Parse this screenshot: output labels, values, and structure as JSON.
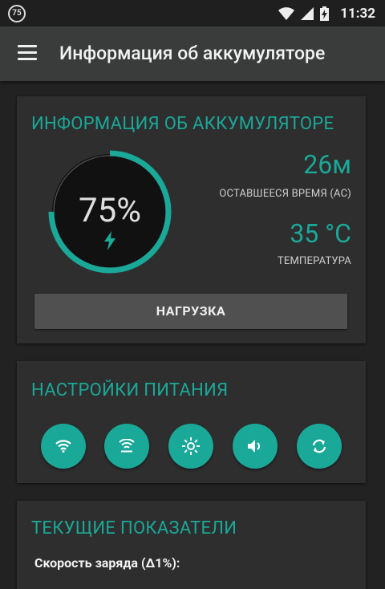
{
  "status_bar": {
    "notification": "75",
    "time": "11:32",
    "icons": [
      "wifi-icon",
      "signal-icon",
      "battery-charging-icon"
    ]
  },
  "app_bar": {
    "title": "Информация об аккумуляторе",
    "menu_icon": "hamburger-menu-icon"
  },
  "battery_card": {
    "title": "ИНФОРМАЦИЯ ОБ АККУМУЛЯТОРЕ",
    "percent_text": "75%",
    "level": 0.75,
    "time_value": "26м",
    "time_label": "ОСТАВШЕЕСЯ ВРЕМЯ (AC)",
    "temp_value": "35 °C",
    "temp_label": "ТЕМПЕРАТУРА",
    "load_button": "НАГРУЗКА",
    "accent_color": "#1aa898"
  },
  "power_card": {
    "title": "НАСТРОЙКИ ПИТАНИЯ",
    "toggles": [
      "wifi-icon",
      "wifi-tethering-icon",
      "brightness-icon",
      "volume-icon",
      "sync-icon"
    ]
  },
  "metrics_card": {
    "title": "ТЕКУЩИЕ ПОКАЗАТЕЛИ",
    "charge_rate_label": "Скорость заряда (Δ1%):"
  }
}
